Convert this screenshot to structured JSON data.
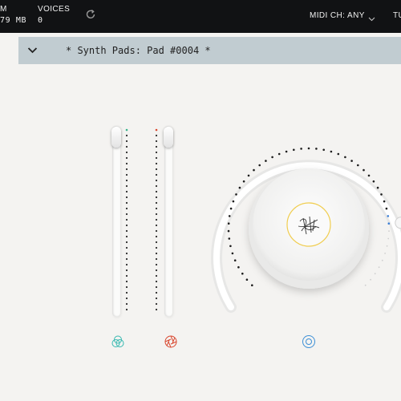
{
  "header": {
    "mem_label": "M",
    "mem_value": "79 MB",
    "voices_label": "VOICES",
    "voices_value": "0",
    "midi_label": "MIDI CH:",
    "midi_value": "ANY",
    "tune_label": "TU"
  },
  "preset": {
    "name": "* Synth Pads: Pad #0004 *"
  },
  "controls": {
    "fader_1": {
      "level": 0.97,
      "marker_color": "#37b38a"
    },
    "fader_2": {
      "level": 0.97,
      "marker_color": "#d9472f"
    },
    "knob": {
      "level": 0.82,
      "marker_color": "#3c7fd6",
      "center_ring_color": "#f0cd4f"
    }
  },
  "icons": {
    "reload": "reload-icon",
    "chevron": "chevron-down-icon",
    "midi_dropdown": "chevron-down-icon",
    "fader_1_icon": "tri-circles-icon",
    "fader_2_icon": "aperture-icon",
    "knob_icon": "concentric-circle-icon",
    "knob_center": "scribble-logo-icon"
  },
  "colors": {
    "topbar": "#111214",
    "preset_bar": "#c1ccd1",
    "teal_icon": "#36b8b0",
    "red_icon": "#d9472f",
    "blue_icon": "#3c8fd6"
  }
}
